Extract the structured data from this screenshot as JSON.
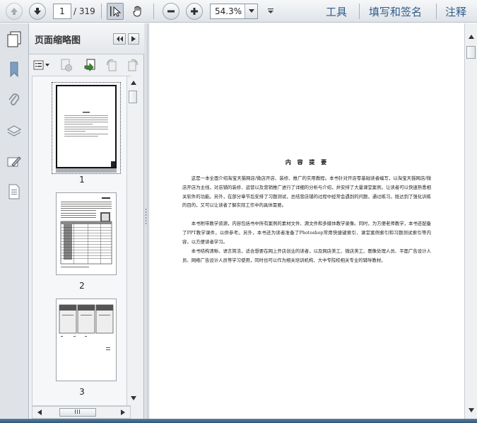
{
  "toolbar": {
    "current_page": "1",
    "total_pages": "/ 319",
    "zoom_value": "54.3%",
    "tools_label": "工具",
    "sign_label": "填写和签名",
    "comment_label": "注释"
  },
  "panel": {
    "title": "页面缩略图",
    "thumbnails": [
      {
        "number": "1"
      },
      {
        "number": "2"
      },
      {
        "number": "3"
      }
    ]
  },
  "document": {
    "title": "内 容 提 要",
    "paragraphs": [
      "这是一本全面介绍淘宝天猫网店/微店开店、装修、推广的实用教程。本书针对开店零基础读者编写，以淘宝天猫网店/微店开店为主线，对店铺的装修、运营以及营销推广进行了详细的分析与介绍，并安排了大量课堂案例，让读者可以快速熟悉相关软件的功能。另外，在部分章节后安排了习题测试，总结营店铺的过程中经常会遇到的问题，通过练习，既达到了强化训练的目的，又可以让读者了解实际工作中的具体需要。",
      "本书附带教学资源，内容包括书中所有案例的素材文件、源文件和多媒体教学录像。同时，为方便老师教学，本书还配备了PPT教学课件，以供参考。另外，本书还为读者准备了Photoshop常用快捷键索引、课堂案例索引和习题测试索引等内容，以方便读者学习。",
      "本书结构清晰、语言简洁，适合想要在网上开店创业的读者，以及网店美工、微店美工、图像处理人员、平面广告设计人员、网络广告设计人员等学习使用，同时也可以作为相关培训机构、大中专院校相关专业的辅导教材。"
    ]
  },
  "colors": {
    "accent": "#2f5d8a",
    "toolbar_bg": "#dfe3e8"
  }
}
